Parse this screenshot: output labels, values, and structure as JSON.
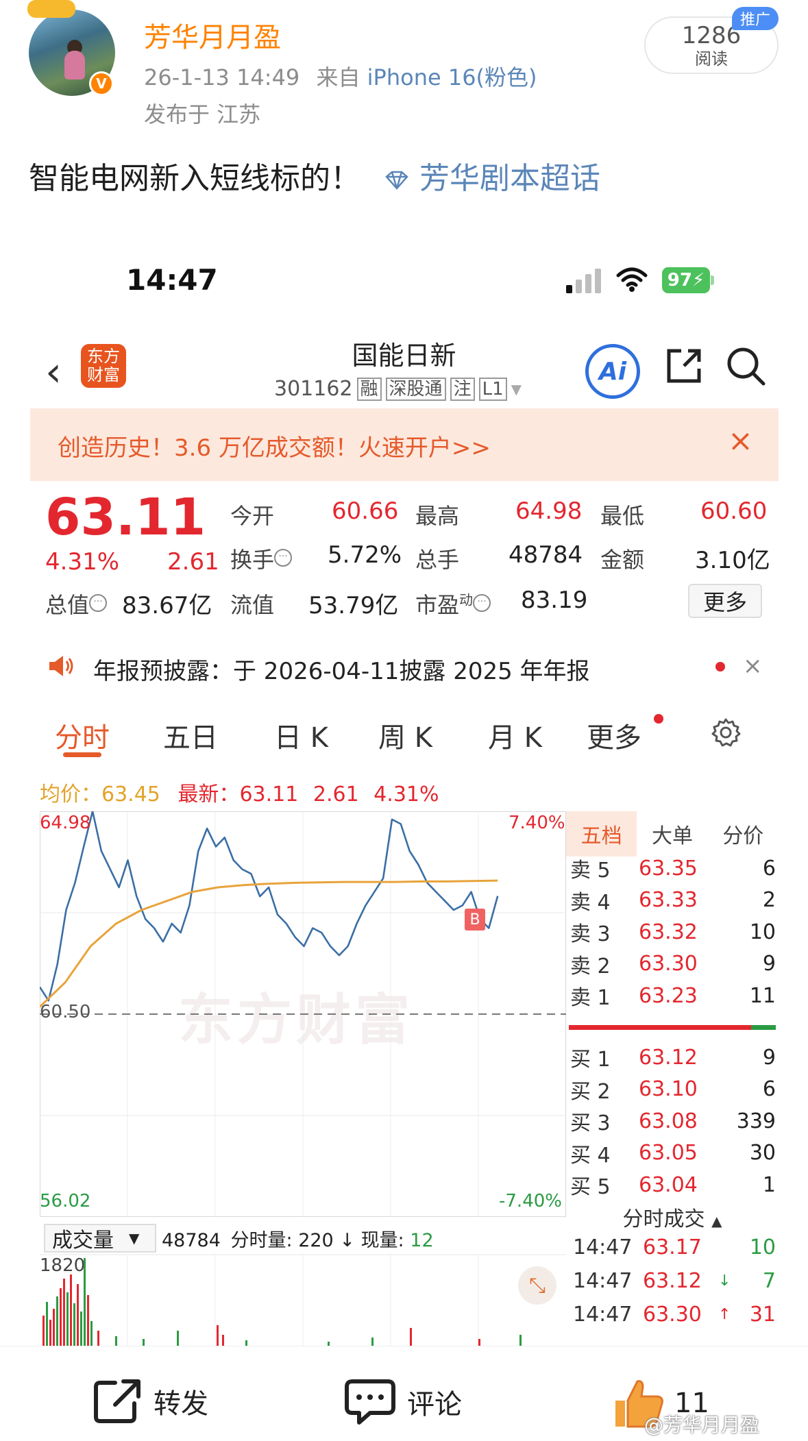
{
  "post": {
    "username": "芳华月月盈",
    "time": "26-1-13 14:49",
    "from_label": "来自",
    "device": "iPhone 16(粉色)",
    "location": "发布于 江苏",
    "read_count": "1286",
    "read_label": "阅读",
    "promo_tag": "推广",
    "text": "智能电网新入短线标的！",
    "topic": "芳华剧本超话"
  },
  "status_bar": {
    "time": "14:47",
    "battery": "97"
  },
  "stock": {
    "name": "国能日新",
    "code": "301162",
    "tags": [
      "融",
      "深股通",
      "注",
      "L1"
    ],
    "ai_label": "Ai",
    "price": "63.11",
    "pct": "4.31%",
    "change": "2.61",
    "quotes": [
      {
        "label": "今开",
        "value": "60.66",
        "color": "red"
      },
      {
        "label": "最高",
        "value": "64.98",
        "color": "red"
      },
      {
        "label": "最低",
        "value": "60.60",
        "color": "red"
      },
      {
        "label": "换手",
        "value": "5.72%",
        "color": "black"
      },
      {
        "label": "总手",
        "value": "48784",
        "color": "black"
      },
      {
        "label": "金额",
        "value": "3.10亿",
        "color": "black"
      },
      {
        "label": "总值",
        "value": "83.67亿",
        "color": "black"
      },
      {
        "label": "流值",
        "value": "53.79亿",
        "color": "black"
      },
      {
        "label": "市盈",
        "value": "83.19",
        "color": "black"
      }
    ],
    "pe_sup": "动",
    "more_label": "更多"
  },
  "banner": {
    "text": "创造历史！3.6 万亿成交额！火速开户>>",
    "close": "×"
  },
  "notice": {
    "text": "年报预披露：于 2026-04-11披露 2025 年年报",
    "close": "×"
  },
  "tabs": [
    "分时",
    "五日",
    "日 K",
    "周 K",
    "月 K",
    "更多"
  ],
  "summary": {
    "avg_label": "均价：",
    "avg": "63.45",
    "latest_label": "最新：",
    "latest": "63.11",
    "change": "2.61",
    "pct": "4.31%"
  },
  "chart_data": {
    "type": "line",
    "title": "",
    "y_axis_left": {
      "top": "64.98",
      "mid": "60.50",
      "bottom": "56.02"
    },
    "y_axis_right": {
      "top": "7.40%",
      "bottom": "-7.40%"
    },
    "ylim": [
      56.02,
      64.98
    ],
    "prev_close": 60.5,
    "series": [
      {
        "name": "最新",
        "color": "#3a6ea5",
        "values": [
          61.1,
          60.8,
          61.6,
          62.8,
          63.4,
          64.2,
          64.98,
          64.1,
          63.7,
          63.3,
          63.9,
          63.1,
          62.6,
          62.4,
          62.1,
          62.5,
          62.3,
          62.9,
          64.1,
          64.6,
          64.2,
          64.4,
          63.9,
          63.7,
          63.6,
          63.1,
          63.3,
          62.7,
          62.5,
          62.2,
          62.0,
          62.4,
          62.3,
          62.0,
          61.8,
          62.0,
          62.5,
          62.9,
          63.2,
          63.5,
          64.8,
          64.7,
          64.1,
          63.8,
          63.4,
          63.2,
          63.0,
          62.8,
          62.9,
          63.2,
          62.6,
          62.4,
          63.11
        ]
      },
      {
        "name": "均价",
        "color": "#e8a33a",
        "values": [
          60.66,
          61.2,
          62.0,
          62.5,
          62.8,
          63.0,
          63.2,
          63.3,
          63.35,
          63.38,
          63.4,
          63.41,
          63.42,
          63.42,
          63.42,
          63.43,
          63.43,
          63.44,
          63.45
        ]
      }
    ],
    "volume": {
      "label": "成交量",
      "total": "48784",
      "minute_label": "分时量:",
      "minute": "220",
      "now_label": "现量:",
      "now": "12",
      "max": "1820"
    }
  },
  "order_book": {
    "tabs": [
      "五档",
      "大单",
      "分价"
    ],
    "asks": [
      {
        "label": "卖 5",
        "price": "63.35",
        "vol": "6"
      },
      {
        "label": "卖 4",
        "price": "63.33",
        "vol": "2"
      },
      {
        "label": "卖 3",
        "price": "63.32",
        "vol": "10"
      },
      {
        "label": "卖 2",
        "price": "63.30",
        "vol": "9"
      },
      {
        "label": "卖 1",
        "price": "63.23",
        "vol": "11"
      }
    ],
    "bids": [
      {
        "label": "买 1",
        "price": "63.12",
        "vol": "9"
      },
      {
        "label": "买 2",
        "price": "63.10",
        "vol": "6"
      },
      {
        "label": "买 3",
        "price": "63.08",
        "vol": "339"
      },
      {
        "label": "买 4",
        "price": "63.05",
        "vol": "30"
      },
      {
        "label": "买 5",
        "price": "63.04",
        "vol": "1"
      }
    ],
    "ticks_label": "分时成交",
    "ticks": [
      {
        "time": "14:47",
        "price": "63.17",
        "arrow": "",
        "vol": "10",
        "vol_color": "#2a9b43"
      },
      {
        "time": "14:47",
        "price": "63.12",
        "arrow": "↓",
        "vol": "7",
        "vol_color": "#2a9b43"
      },
      {
        "time": "14:47",
        "price": "63.30",
        "arrow": "↑",
        "vol": "31",
        "vol_color": "#e3272f"
      }
    ]
  },
  "actions": {
    "repost": "转发",
    "comment": "评论",
    "likes": "11"
  },
  "watermark": "@芳华月月盈",
  "colors": {
    "red": "#e3272f",
    "green": "#2a9b43",
    "orange": "#ff8200",
    "price_line": "#3a6ea5",
    "avg_line": "#e8a33a"
  }
}
